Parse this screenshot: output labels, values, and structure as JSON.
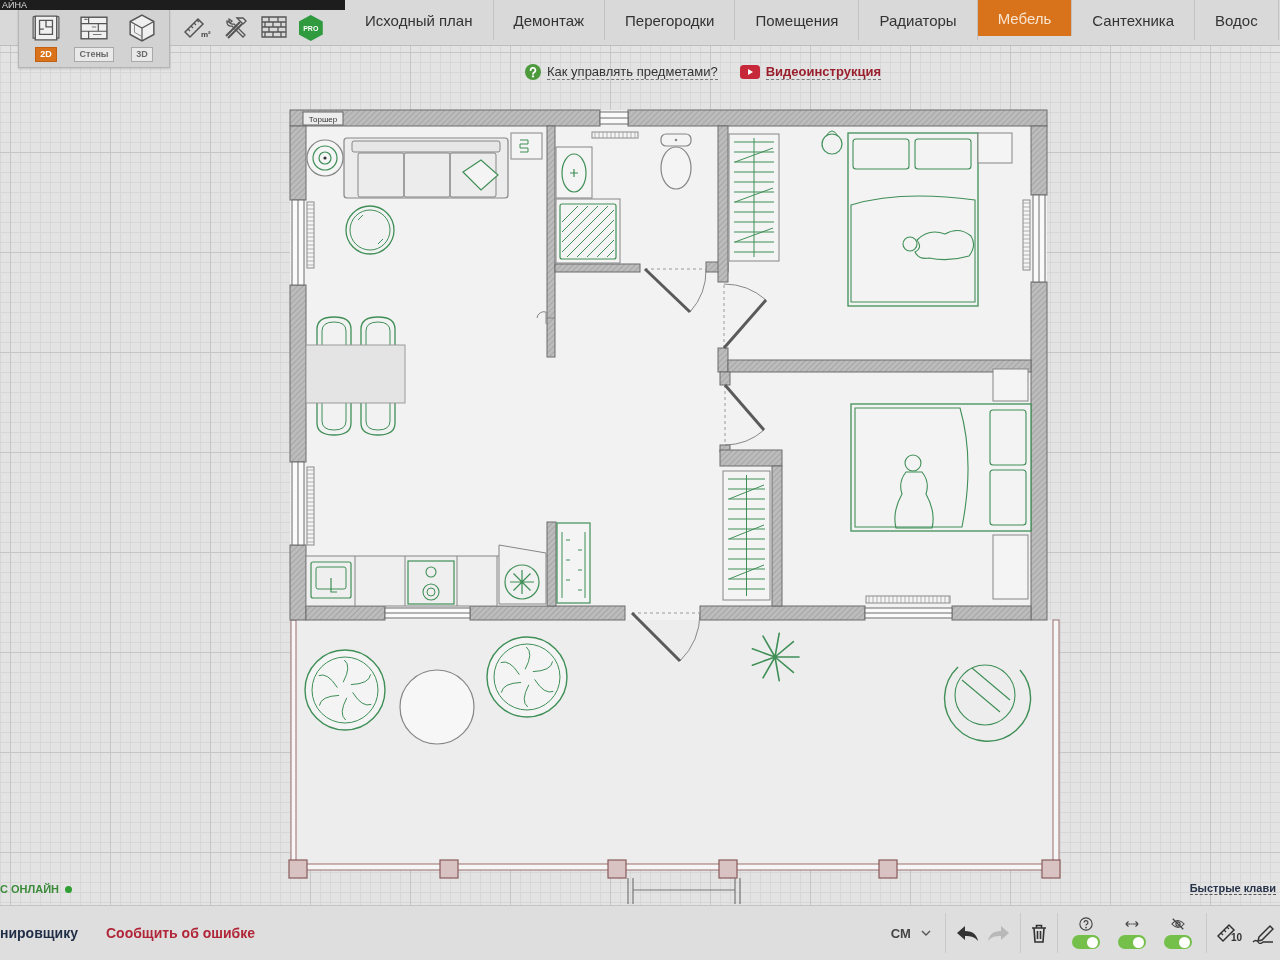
{
  "title_strip": {
    "text": "АЙНА"
  },
  "view_modes": [
    {
      "kind": "plan",
      "label": "2D",
      "selected": true
    },
    {
      "kind": "walls",
      "label": "Стены",
      "selected": false
    },
    {
      "kind": "cube",
      "label": "3D",
      "selected": false
    }
  ],
  "tools": [
    {
      "kind": "area",
      "label": "m²"
    },
    {
      "kind": "repair"
    },
    {
      "kind": "bricks"
    },
    {
      "kind": "pro",
      "label": "PRO"
    }
  ],
  "tabs": [
    {
      "label": "Исходный план",
      "selected": false
    },
    {
      "label": "Демонтаж",
      "selected": false
    },
    {
      "label": "Перегородки",
      "selected": false
    },
    {
      "label": "Помещения",
      "selected": false
    },
    {
      "label": "Радиаторы",
      "selected": false
    },
    {
      "label": "Мебель",
      "selected": true
    },
    {
      "label": "Сантехника",
      "selected": false
    },
    {
      "label": "Водос",
      "selected": false
    }
  ],
  "help_links": [
    {
      "kind": "question",
      "label": "Как управлять предметами?"
    },
    {
      "kind": "video",
      "label": "Видеоинструкция"
    }
  ],
  "floor_plan": {
    "tooltip": "Торшер"
  },
  "online_status": {
    "label": "С ОНЛАЙН"
  },
  "shortcuts_link": {
    "label": "Быстрые клави"
  },
  "bottom_bar": {
    "links": [
      {
        "kind": "plain",
        "label": "нировщику"
      },
      {
        "kind": "alert",
        "label": "Сообщить об ошибке"
      }
    ],
    "units": {
      "value": "СМ"
    },
    "history": [
      {
        "kind": "undo",
        "disabled": false
      },
      {
        "kind": "redo",
        "disabled": true
      }
    ],
    "toggles": [
      {
        "kind": "help",
        "on": true
      },
      {
        "kind": "dimensions",
        "on": true
      },
      {
        "kind": "visibility",
        "on": true
      }
    ],
    "scale": {
      "label": "10"
    }
  }
}
